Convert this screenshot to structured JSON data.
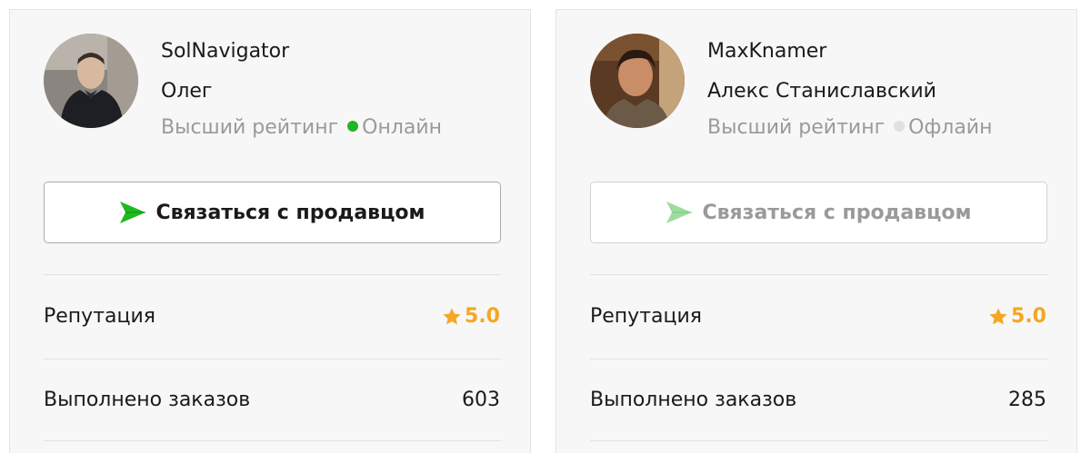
{
  "sellers": [
    {
      "username": "SolNavigator",
      "full_name": "Олег",
      "rating_label": "Высший рейтинг",
      "status_label": "Онлайн",
      "status_color": "#22b422",
      "contact_button_label": "Связаться с продавцом",
      "contact_enabled": true,
      "reputation_label": "Репутация",
      "reputation_value": "5.0",
      "orders_label": "Выполнено заказов",
      "orders_value": "603"
    },
    {
      "username": "MaxKnamer",
      "full_name": "Алекс Станиславский",
      "rating_label": "Высший рейтинг",
      "status_label": "Офлайн",
      "status_color": "#e0e0e0",
      "contact_button_label": "Связаться с продавцом",
      "contact_enabled": false,
      "reputation_label": "Репутация",
      "reputation_value": "5.0",
      "orders_label": "Выполнено заказов",
      "orders_value": "285"
    }
  ],
  "colors": {
    "accent_green": "#1fb91f",
    "star_color": "#f5a623",
    "card_background": "#f7f7f7"
  },
  "icons": {
    "send": "send-icon",
    "star": "star-icon",
    "status": "status-dot-icon"
  }
}
